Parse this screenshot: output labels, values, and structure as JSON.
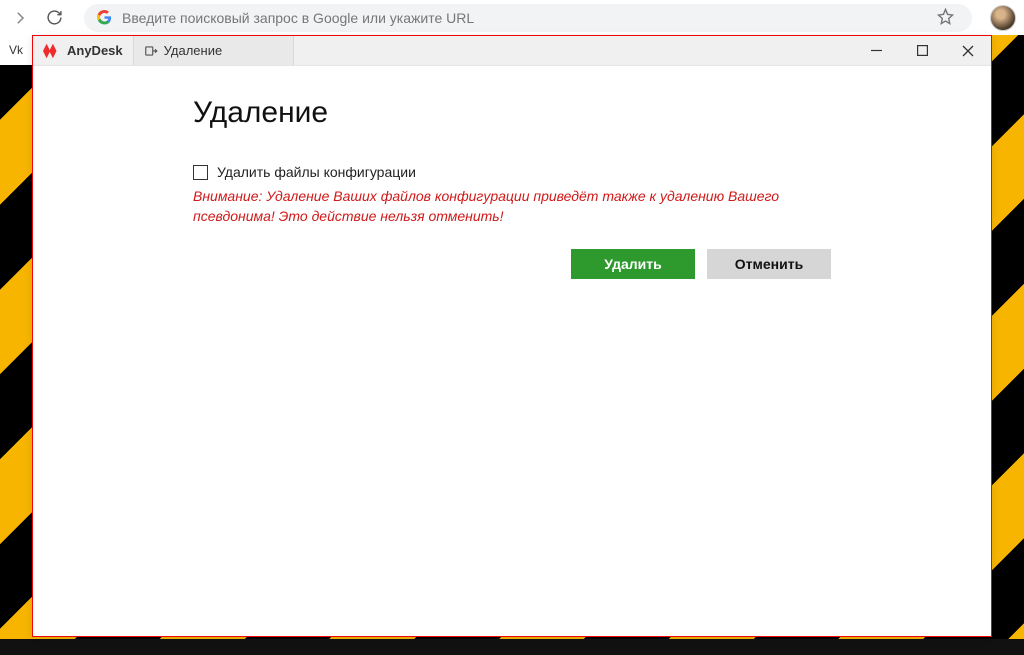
{
  "browser": {
    "omnibox_placeholder": "Введите поисковый запрос в Google или укажите URL",
    "bookmark_label": "Vk"
  },
  "window": {
    "app_name": "AnyDesk",
    "tab_title": "Удаление"
  },
  "dialog": {
    "heading": "Удаление",
    "checkbox_label": "Удалить файлы конфигурации",
    "warning_text": "Внимание: Удаление Ваших файлов конфигурации приведёт также к удалению Вашего псевдонима! Это действие нельзя отменить!",
    "delete_button": "Удалить",
    "cancel_button": "Отменить"
  },
  "colors": {
    "brand_red": "#ef2b2b",
    "primary_green": "#2e9a2e",
    "warning_red": "#d01919"
  }
}
